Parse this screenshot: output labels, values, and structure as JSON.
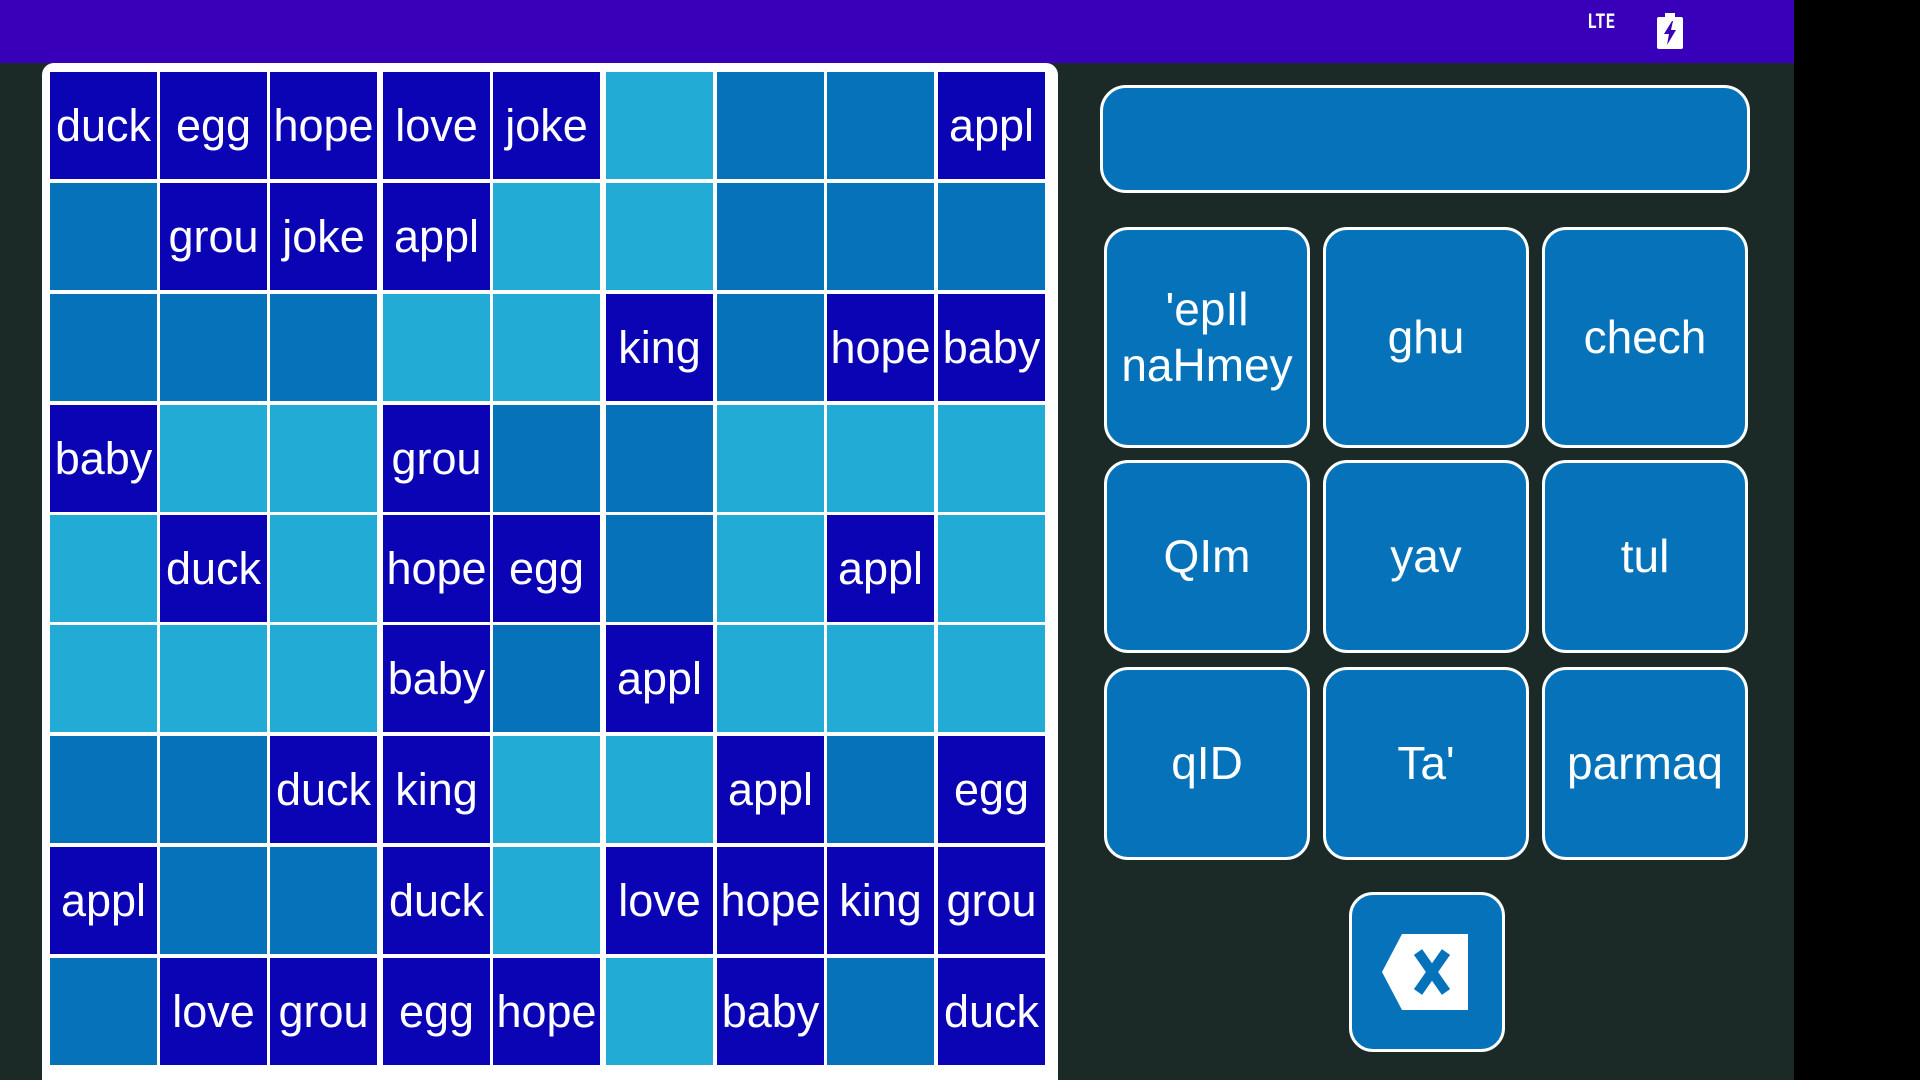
{
  "status_bar": {
    "network": "LTE",
    "battery_icon": "battery-charging-icon"
  },
  "grid": {
    "rows": [
      [
        {
          "t": "duck",
          "c": "dark"
        },
        {
          "t": "egg",
          "c": "dark"
        },
        {
          "t": "hope",
          "c": "dark"
        },
        {
          "t": "love",
          "c": "dark"
        },
        {
          "t": "joke",
          "c": "dark"
        },
        {
          "t": "",
          "c": "light"
        },
        {
          "t": "",
          "c": "mid"
        },
        {
          "t": "",
          "c": "mid"
        },
        {
          "t": "appl",
          "c": "dark"
        }
      ],
      [
        {
          "t": "",
          "c": "mid"
        },
        {
          "t": "grou",
          "c": "dark"
        },
        {
          "t": "joke",
          "c": "dark"
        },
        {
          "t": "appl",
          "c": "dark"
        },
        {
          "t": "",
          "c": "light"
        },
        {
          "t": "",
          "c": "light"
        },
        {
          "t": "",
          "c": "mid"
        },
        {
          "t": "",
          "c": "mid"
        },
        {
          "t": "",
          "c": "mid"
        }
      ],
      [
        {
          "t": "",
          "c": "mid"
        },
        {
          "t": "",
          "c": "mid"
        },
        {
          "t": "",
          "c": "mid"
        },
        {
          "t": "",
          "c": "light"
        },
        {
          "t": "",
          "c": "light"
        },
        {
          "t": "king",
          "c": "dark"
        },
        {
          "t": "",
          "c": "mid"
        },
        {
          "t": "hope",
          "c": "dark"
        },
        {
          "t": "baby",
          "c": "dark"
        }
      ],
      [
        {
          "t": "baby",
          "c": "dark"
        },
        {
          "t": "",
          "c": "light"
        },
        {
          "t": "",
          "c": "light"
        },
        {
          "t": "grou",
          "c": "dark"
        },
        {
          "t": "",
          "c": "mid"
        },
        {
          "t": "",
          "c": "mid"
        },
        {
          "t": "",
          "c": "light"
        },
        {
          "t": "",
          "c": "light"
        },
        {
          "t": "",
          "c": "light"
        }
      ],
      [
        {
          "t": "",
          "c": "light"
        },
        {
          "t": "duck",
          "c": "dark"
        },
        {
          "t": "",
          "c": "light"
        },
        {
          "t": "hope",
          "c": "dark"
        },
        {
          "t": "egg",
          "c": "dark"
        },
        {
          "t": "",
          "c": "mid"
        },
        {
          "t": "",
          "c": "light"
        },
        {
          "t": "appl",
          "c": "dark"
        },
        {
          "t": "",
          "c": "light"
        }
      ],
      [
        {
          "t": "",
          "c": "light"
        },
        {
          "t": "",
          "c": "light"
        },
        {
          "t": "",
          "c": "light"
        },
        {
          "t": "baby",
          "c": "dark"
        },
        {
          "t": "",
          "c": "mid"
        },
        {
          "t": "appl",
          "c": "dark"
        },
        {
          "t": "",
          "c": "light"
        },
        {
          "t": "",
          "c": "light"
        },
        {
          "t": "",
          "c": "light"
        }
      ],
      [
        {
          "t": "",
          "c": "mid"
        },
        {
          "t": "",
          "c": "mid"
        },
        {
          "t": "duck",
          "c": "dark"
        },
        {
          "t": "king",
          "c": "dark"
        },
        {
          "t": "",
          "c": "light"
        },
        {
          "t": "",
          "c": "light"
        },
        {
          "t": "appl",
          "c": "dark"
        },
        {
          "t": "",
          "c": "mid"
        },
        {
          "t": "egg",
          "c": "dark"
        }
      ],
      [
        {
          "t": "appl",
          "c": "dark"
        },
        {
          "t": "",
          "c": "mid"
        },
        {
          "t": "",
          "c": "mid"
        },
        {
          "t": "duck",
          "c": "dark"
        },
        {
          "t": "",
          "c": "light"
        },
        {
          "t": "love",
          "c": "dark"
        },
        {
          "t": "hope",
          "c": "dark"
        },
        {
          "t": "king",
          "c": "dark"
        },
        {
          "t": "grou",
          "c": "dark"
        }
      ],
      [
        {
          "t": "",
          "c": "mid"
        },
        {
          "t": "love",
          "c": "dark"
        },
        {
          "t": "grou",
          "c": "dark"
        },
        {
          "t": "egg",
          "c": "dark"
        },
        {
          "t": "hope",
          "c": "dark"
        },
        {
          "t": "",
          "c": "light"
        },
        {
          "t": "baby",
          "c": "dark"
        },
        {
          "t": "",
          "c": "mid"
        },
        {
          "t": "duck",
          "c": "dark"
        }
      ]
    ]
  },
  "answer": {
    "value": ""
  },
  "options": [
    {
      "label": "'epIl\nnaHmey"
    },
    {
      "label": "ghu"
    },
    {
      "label": "chech"
    },
    {
      "label": "QIm"
    },
    {
      "label": "yav"
    },
    {
      "label": "tul"
    },
    {
      "label": "qID"
    },
    {
      "label": "Ta'"
    },
    {
      "label": "parmaq"
    }
  ],
  "backspace": {
    "icon": "backspace-icon"
  },
  "colors": {
    "status_bar": "#3800b8",
    "background": "#1b2a27",
    "cell_dark": "#0a04b4",
    "cell_mid": "#0572ba",
    "cell_light": "#22abd4",
    "button": "#0572ba",
    "border": "#ffffff"
  }
}
